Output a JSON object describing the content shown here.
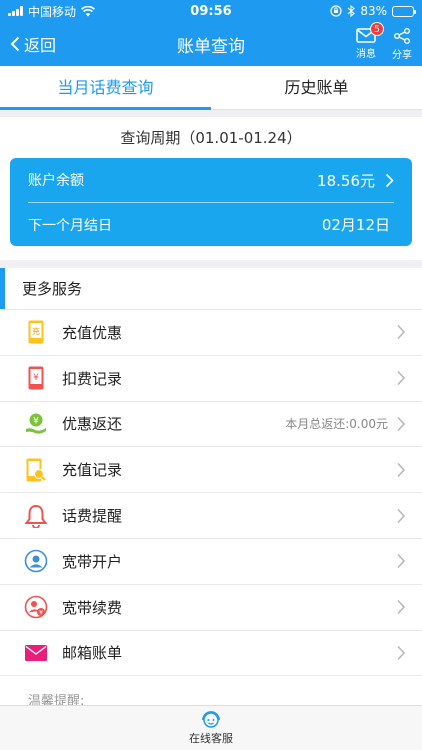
{
  "status_bar": {
    "carrier": "中国移动",
    "time": "09:56",
    "battery": "83%",
    "battery_level": 0.83
  },
  "nav": {
    "back_label": "返回",
    "title": "账单查询",
    "messages_label": "消息",
    "messages_badge": "5",
    "share_label": "分享"
  },
  "tabs": [
    {
      "label": "当月话费查询",
      "active": true
    },
    {
      "label": "历史账单",
      "active": false
    }
  ],
  "bill": {
    "period": "查询周期（01.01-01.24）",
    "balance_label": "账户余额",
    "balance_value": "18.56元",
    "next_date_label": "下一个月结日",
    "next_date_value": "02月12日"
  },
  "services": {
    "heading": "更多服务",
    "items": [
      {
        "label": "充值优惠",
        "icon": "recharge-offer-icon"
      },
      {
        "label": "扣费记录",
        "icon": "deduction-record-icon"
      },
      {
        "label": "优惠返还",
        "icon": "rebate-icon",
        "extra": "本月总返还:0.00元"
      },
      {
        "label": "充值记录",
        "icon": "recharge-record-icon"
      },
      {
        "label": "话费提醒",
        "icon": "bell-icon"
      },
      {
        "label": "宽带开户",
        "icon": "broadband-open-icon"
      },
      {
        "label": "宽带续费",
        "icon": "broadband-renew-icon"
      },
      {
        "label": "邮箱账单",
        "icon": "mail-bill-icon"
      }
    ]
  },
  "tip_label": "温馨提醒:",
  "bottom": {
    "label": "在线客服"
  },
  "colors": {
    "accent": "#1e9bf0",
    "card": "#1aa6ef",
    "badge": "#f23b3b"
  }
}
